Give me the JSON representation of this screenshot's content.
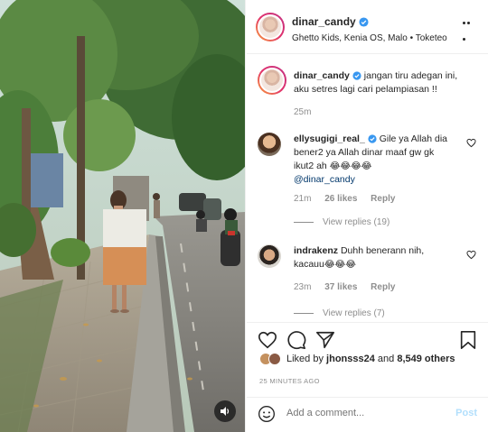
{
  "post": {
    "author": "dinar_candy",
    "audio": "Ghetto Kids, Kenia OS, Malo • Toketeo",
    "caption": "jangan tiru adegan ini, aku setres lagi cari pelampiasan !!",
    "caption_time": "25m"
  },
  "comments": [
    {
      "user": "ellysugigi_real_",
      "text": "Gile ya Allah dia bener2 ya Allah dinar maaf gw gk ikut2 ah",
      "emojis": "😂😂😂😂",
      "mention": "@dinar_candy",
      "time": "21m",
      "likes": "26 likes",
      "reply": "Reply",
      "view_replies": "View replies (19)"
    },
    {
      "user": "indrakenz",
      "text": "Duhh benerann nih, kacauu",
      "emojis": "😂😂😂",
      "time": "23m",
      "likes": "37 likes",
      "reply": "Reply",
      "view_replies": "View replies (7)"
    }
  ],
  "likes": {
    "prefix": "Liked by",
    "user": "jhonsss24",
    "and": "and",
    "others": "8,549 others"
  },
  "timestamp": "25 MINUTES AGO",
  "add_comment": {
    "placeholder": "Add a comment...",
    "post_label": "Post"
  },
  "colors": {
    "verified": "#3897f0",
    "link_blue": "#00376b",
    "post_disabled": "#b2dffc",
    "muted": "#8e8e8e"
  },
  "icons": [
    "verified-badge-icon",
    "more-options-icon",
    "heart-icon",
    "comment-icon",
    "share-icon",
    "bookmark-icon",
    "emoji-icon",
    "sound-icon"
  ]
}
